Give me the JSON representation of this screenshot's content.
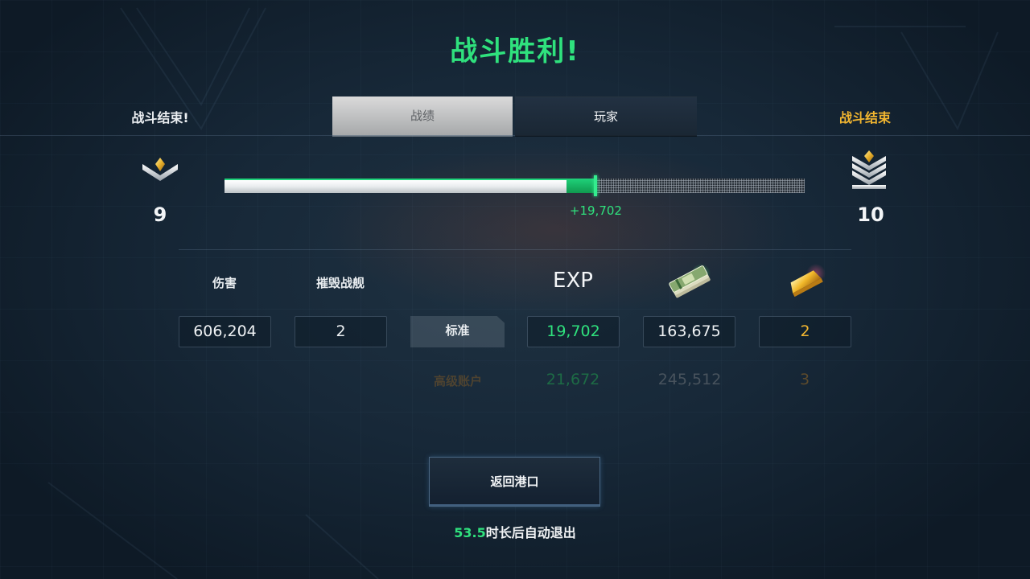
{
  "title": "战斗胜利!",
  "header": {
    "left_status": "战斗结束!",
    "right_status": "战斗结束",
    "tabs": [
      {
        "label": "战绩",
        "selected": true
      },
      {
        "label": "玩家",
        "selected": false
      }
    ]
  },
  "rank": {
    "current": {
      "level": "9",
      "icon": "rank-chevron-single-icon"
    },
    "next": {
      "level": "10",
      "icon": "rank-chevron-triple-icon"
    },
    "progress_before": 0.59,
    "progress_after": 0.64,
    "gain_label": "+19,702"
  },
  "stats": {
    "columns": {
      "damage": "伤害",
      "ships_destroyed": "摧毁战舰",
      "exp": "EXP",
      "credits_icon": "cash-stack-icon",
      "gold_icon": "gold-bar-icon"
    },
    "standard": {
      "label": "标准",
      "damage": "606,204",
      "ships_destroyed": "2",
      "exp": "19,702",
      "credits": "163,675",
      "gold": "2"
    },
    "premium": {
      "label": "高级账户",
      "exp": "21,672",
      "credits": "245,512",
      "gold": "3"
    }
  },
  "footer": {
    "return_button": "返回港口",
    "countdown_seconds": "53.5",
    "countdown_suffix": "时长后自动退出"
  },
  "colors": {
    "accent_green": "#2fe17d",
    "gold": "#f2b630",
    "premium_label": "#4e4330",
    "premium_exp": "#1d6b45",
    "premium_credits": "#48535d",
    "premium_gold": "#5c4a2c"
  }
}
